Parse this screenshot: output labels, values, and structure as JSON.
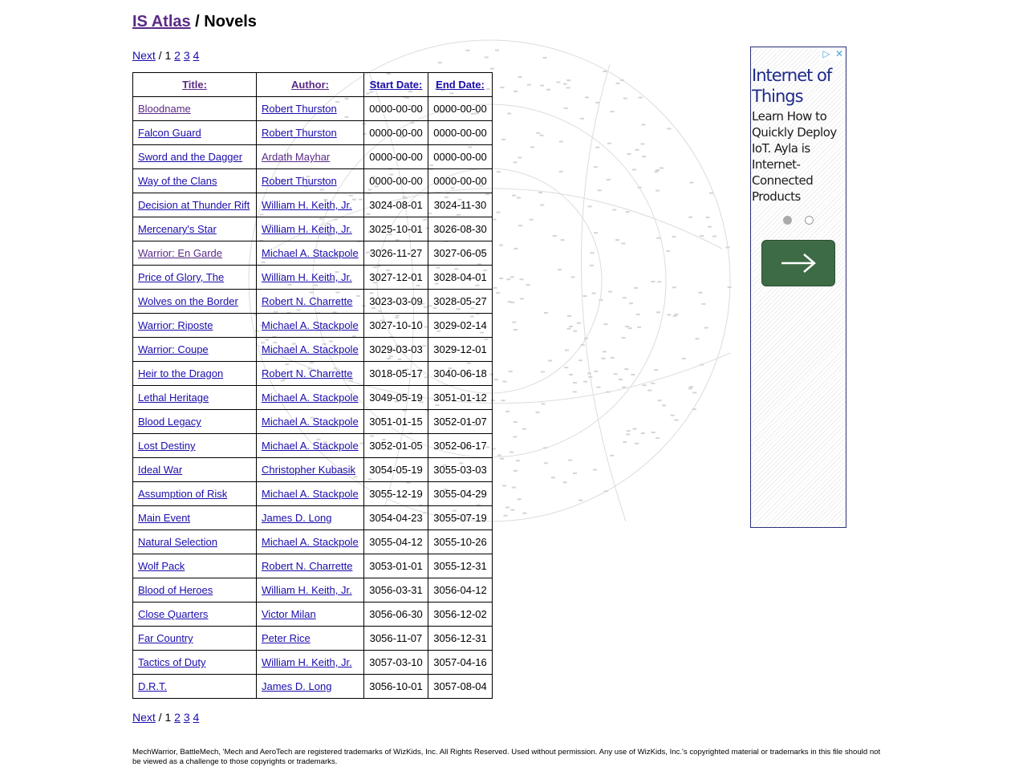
{
  "header": {
    "site_link": "IS Atlas",
    "separator": " / ",
    "page_title": "Novels"
  },
  "pager": {
    "next": "Next",
    "slash": " / ",
    "current": "1",
    "pages": [
      "2",
      "3",
      "4"
    ]
  },
  "table": {
    "headers": [
      "Title:",
      "Author:",
      "Start Date:",
      "End Date:"
    ],
    "rows": [
      {
        "title": "Bloodname",
        "author": "Robert Thurston",
        "start": "0000-00-00",
        "end": "0000-00-00"
      },
      {
        "title": "Falcon Guard",
        "author": "Robert Thurston",
        "start": "0000-00-00",
        "end": "0000-00-00"
      },
      {
        "title": "Sword and the Dagger",
        "author": "Ardath Mayhar",
        "start": "0000-00-00",
        "end": "0000-00-00"
      },
      {
        "title": "Way of the Clans",
        "author": "Robert Thurston",
        "start": "0000-00-00",
        "end": "0000-00-00"
      },
      {
        "title": "Decision at Thunder Rift",
        "author": "William H. Keith, Jr.",
        "start": "3024-08-01",
        "end": "3024-11-30"
      },
      {
        "title": "Mercenary's Star",
        "author": "William H. Keith, Jr.",
        "start": "3025-10-01",
        "end": "3026-08-30"
      },
      {
        "title": "Warrior: En Garde",
        "author": "Michael A. Stackpole",
        "start": "3026-11-27",
        "end": "3027-06-05"
      },
      {
        "title": "Price of Glory, The",
        "author": "William H. Keith, Jr.",
        "start": "3027-12-01",
        "end": "3028-04-01"
      },
      {
        "title": "Wolves on the Border",
        "author": "Robert N. Charrette",
        "start": "3023-03-09",
        "end": "3028-05-27"
      },
      {
        "title": "Warrior: Riposte",
        "author": "Michael A. Stackpole",
        "start": "3027-10-10",
        "end": "3029-02-14"
      },
      {
        "title": "Warrior: Coupe",
        "author": "Michael A. Stackpole",
        "start": "3029-03-03",
        "end": "3029-12-01"
      },
      {
        "title": "Heir to the Dragon",
        "author": "Robert N. Charrette",
        "start": "3018-05-17",
        "end": "3040-06-18"
      },
      {
        "title": "Lethal Heritage",
        "author": "Michael A. Stackpole",
        "start": "3049-05-19",
        "end": "3051-01-12"
      },
      {
        "title": "Blood Legacy",
        "author": "Michael A. Stackpole",
        "start": "3051-01-15",
        "end": "3052-01-07"
      },
      {
        "title": "Lost Destiny",
        "author": "Michael A. Stackpole",
        "start": "3052-01-05",
        "end": "3052-06-17"
      },
      {
        "title": "Ideal War",
        "author": "Christopher Kubasik",
        "start": "3054-05-19",
        "end": "3055-03-03"
      },
      {
        "title": "Assumption of Risk",
        "author": "Michael A. Stackpole",
        "start": "3055-12-19",
        "end": "3055-04-29"
      },
      {
        "title": "Main Event",
        "author": "James D. Long",
        "start": "3054-04-23",
        "end": "3055-07-19"
      },
      {
        "title": "Natural Selection",
        "author": "Michael A. Stackpole",
        "start": "3055-04-12",
        "end": "3055-10-26"
      },
      {
        "title": "Wolf Pack",
        "author": "Robert N. Charrette",
        "start": "3053-01-01",
        "end": "3055-12-31"
      },
      {
        "title": "Blood of Heroes",
        "author": "William H. Keith, Jr.",
        "start": "3056-03-31",
        "end": "3056-04-12"
      },
      {
        "title": "Close Quarters",
        "author": "Victor Milan",
        "start": "3056-06-30",
        "end": "3056-12-02"
      },
      {
        "title": "Far Country",
        "author": "Peter Rice",
        "start": "3056-11-07",
        "end": "3056-12-31"
      },
      {
        "title": "Tactics of Duty",
        "author": "William H. Keith, Jr.",
        "start": "3057-03-10",
        "end": "3057-04-16"
      },
      {
        "title": "D.R.T.",
        "author": "James D. Long",
        "start": "3056-10-01",
        "end": "3057-08-04"
      }
    ]
  },
  "ad": {
    "headline": "Internet of Things",
    "body": "Learn How to Quickly Deploy IoT. Ayla is Internet-Connected Products",
    "adchoices_icon": "play-triangle-icon",
    "close_icon": "close-icon",
    "button_icon": "arrow-right-icon",
    "button_color": "#3d6b45"
  },
  "footer": {
    "text": "MechWarrior, BattleMech, 'Mech and AeroTech are registered trademarks of WizKids, Inc. All Rights Reserved. Used without permission. Any use of WizKids, Inc.'s copyrighted material or trademarks in this file should not be viewed as a challenge to those copyrights or trademarks."
  },
  "colors": {
    "link": "#1a0dab",
    "visited_link": "#5a2a86"
  }
}
